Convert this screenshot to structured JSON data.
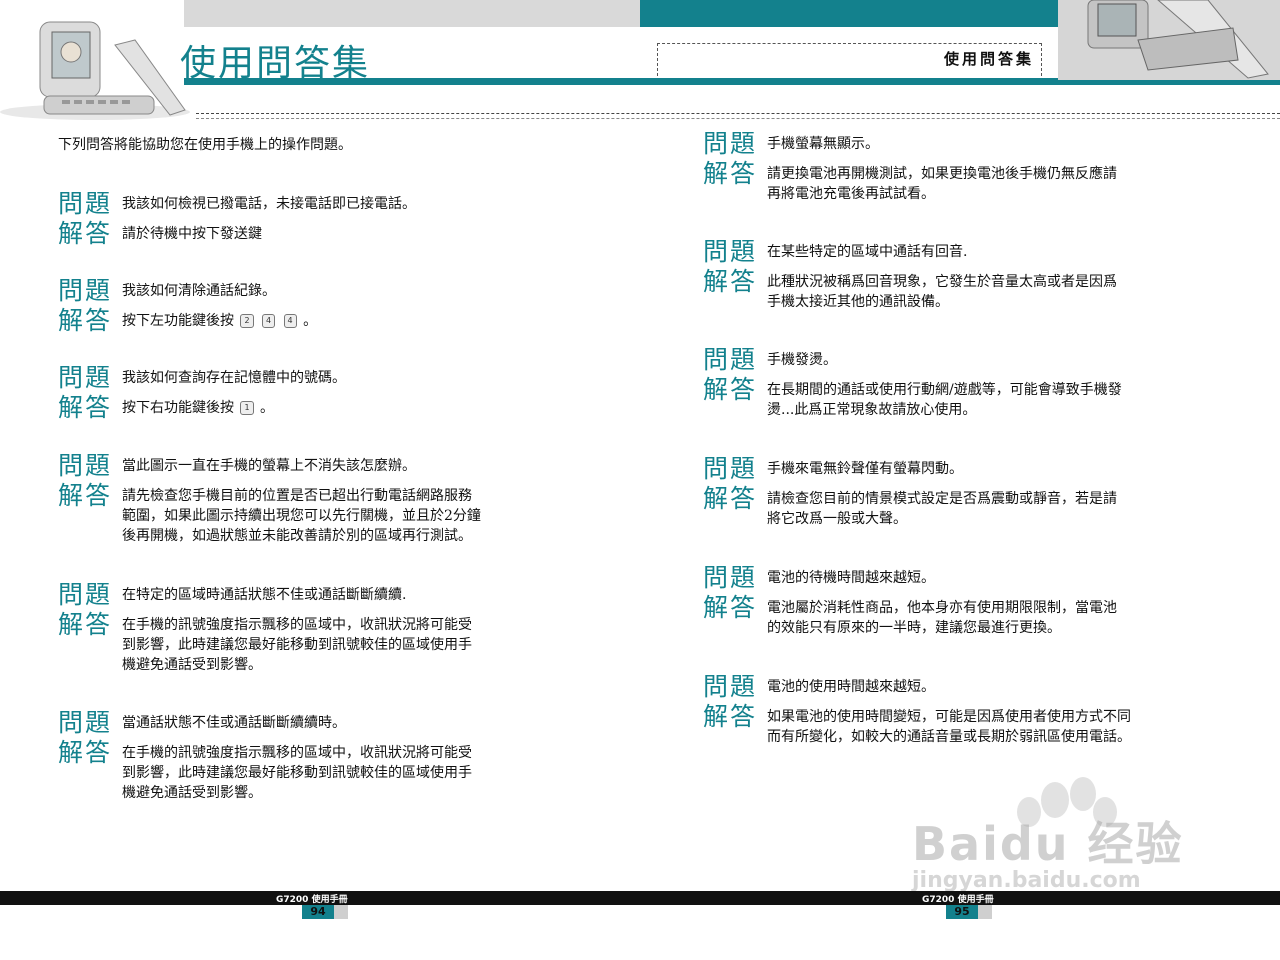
{
  "header": {
    "title": "使用問答集",
    "section_label": "使用問答集"
  },
  "intro": "下列問答將能協助您在使用手機上的操作問題。",
  "labels": {
    "q": "問題",
    "a": "解答"
  },
  "left_qa": [
    {
      "q": "我該如何檢視已撥電話，未接電話即已接電話。",
      "a": [
        "請於待機中按下發送鍵"
      ]
    },
    {
      "q": "我該如何清除通話紀錄。",
      "a": [
        "按下左功能鍵後按 2 4 4 。"
      ]
    },
    {
      "q": "我該如何查詢存在記憶體中的號碼。",
      "a": [
        "按下右功能鍵後按 1 。"
      ]
    },
    {
      "q": "當此圖示一直在手機的螢幕上不消失該怎麼辦。",
      "a": [
        "請先檢查您手機目前的位置是否已超出行動電話網路服務",
        "範圍，如果此圖示持續出現您可以先行關機，並且於2分鐘",
        "後再開機，如過狀態並未能改善請於別的區域再行測試。"
      ]
    },
    {
      "q": "在特定的區域時通話狀態不佳或通話斷斷續續.",
      "a": [
        "在手機的訊號強度指示飄移的區域中，收訊狀況將可能受",
        "到影響，此時建議您最好能移動到訊號較佳的區域使用手",
        "機避免通話受到影響。"
      ]
    },
    {
      "q": "當通話狀態不佳或通話斷斷續續時。",
      "a": [
        "在手機的訊號強度指示飄移的區域中，收訊狀況將可能受",
        "到影響，此時建議您最好能移動到訊號較佳的區域使用手",
        "機避免通話受到影響。"
      ]
    }
  ],
  "right_qa": [
    {
      "q": "手機螢幕無顯示。",
      "a": [
        "請更換電池再開機測試，如果更換電池後手機仍無反應請",
        "再將電池充電後再試試看。"
      ]
    },
    {
      "q": "在某些特定的區域中通話有回音.",
      "a": [
        "此種狀況被稱爲回音現象，它發生於音量太高或者是因爲",
        "手機太接近其他的通訊設備。"
      ]
    },
    {
      "q": "手機發燙。",
      "a": [
        "在長期間的通話或使用行動網/遊戲等，可能會導致手機發",
        "燙...此爲正常現象故請放心使用。"
      ]
    },
    {
      "q": "手機來電無鈴聲僅有螢幕閃動。",
      "a": [
        "請檢查您目前的情景模式設定是否爲震動或靜音，若是請",
        "將它改爲一般或大聲。"
      ]
    },
    {
      "q": "電池的待機時間越來越短。",
      "a": [
        "電池屬於消耗性商品，他本身亦有使用期限限制，當電池",
        "的效能只有原來的一半時，建議您最進行更換。"
      ]
    },
    {
      "q": "電池的使用時間越來越短。",
      "a": [
        "如果電池的使用時間變短，可能是因爲使用者使用方式不同",
        "而有所變化，如較大的通話音量或長期於弱訊區使用電話。"
      ]
    }
  ],
  "keys": {
    "k2": "2",
    "k4a": "4",
    "k4b": "4",
    "k1": "1"
  },
  "footer": {
    "left_label": "G7200 使用手冊",
    "left_page": "94",
    "right_label": "G7200 使用手冊",
    "right_page": "95"
  },
  "watermark": {
    "brand": "Baidu 经验",
    "url": "jingyan.baidu.com"
  },
  "colors": {
    "accent": "#13818d",
    "grey": "#d9d9d9"
  }
}
